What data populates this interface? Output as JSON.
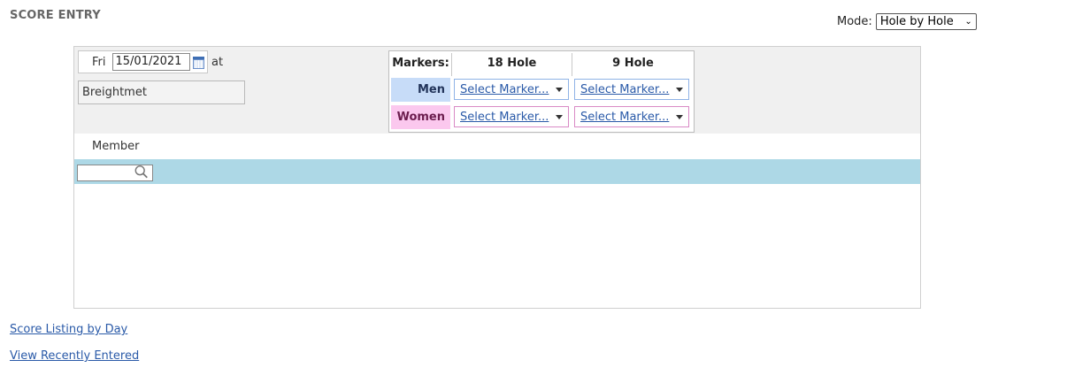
{
  "page": {
    "title": "SCORE ENTRY"
  },
  "mode": {
    "label": "Mode:",
    "value": "Hole by Hole"
  },
  "entry": {
    "day": "Fri",
    "date": "15/01/2021",
    "at_label": "at",
    "course": "Breightmet"
  },
  "markers": {
    "title": "Markers:",
    "columns": [
      "18 Hole",
      "9 Hole"
    ],
    "men": {
      "label": "Men",
      "hole18": "Select Marker...",
      "hole9": "Select Marker..."
    },
    "women": {
      "label": "Women",
      "hole18": "Select Marker...",
      "hole9": "Select Marker..."
    }
  },
  "member": {
    "label": "Member",
    "search_value": ""
  },
  "links": {
    "score_listing": "Score Listing by Day",
    "recently_entered": "View Recently Entered"
  },
  "colors": {
    "men_bg": "#c7dcf8",
    "women_bg": "#fbc8ee",
    "member_row": "#add8e6",
    "link": "#2a5aa8"
  },
  "icons": {
    "calendar": "calendar-icon",
    "search": "search-icon",
    "dropdown": "chevron-down-icon"
  }
}
